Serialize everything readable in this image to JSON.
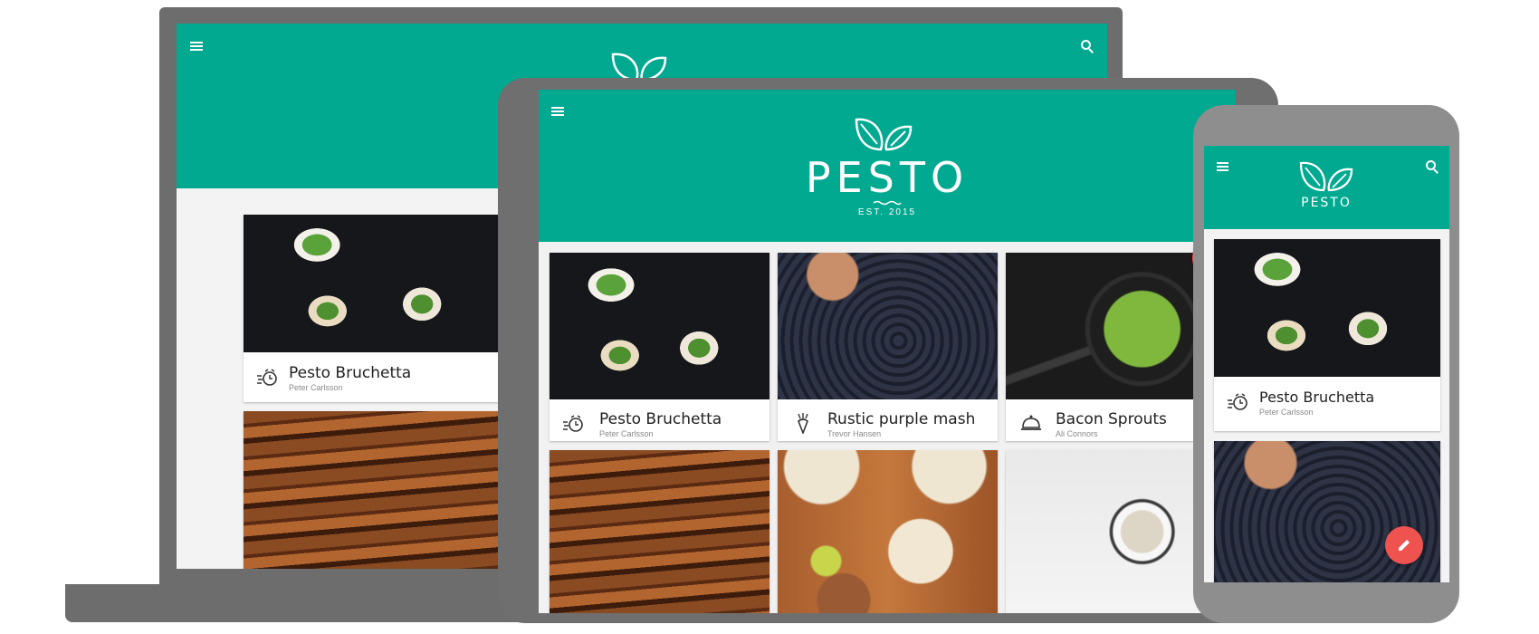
{
  "app": {
    "logo_text": "PESTO",
    "logo_sub": "EST. 2015",
    "colors": {
      "primary": "#00a98f",
      "fab": "#ef5350",
      "card_text": "#212121",
      "author_text": "#8a8a8a"
    }
  },
  "icons": {
    "menu": "menu-icon",
    "search": "search-icon",
    "timer": "timer-icon",
    "carrot": "carrot-icon",
    "cloche": "cloche-icon",
    "edit": "pencil-icon"
  },
  "recipes": [
    {
      "title": "Pesto Bruchetta",
      "author": "Peter Carlsson",
      "icon": "timer-icon"
    },
    {
      "title": "Rustic purple mash",
      "author": "Trevor Hansen",
      "icon": "carrot-icon"
    },
    {
      "title": "Bacon Sprouts",
      "author": "Ali Connors",
      "icon": "cloche-icon"
    }
  ]
}
